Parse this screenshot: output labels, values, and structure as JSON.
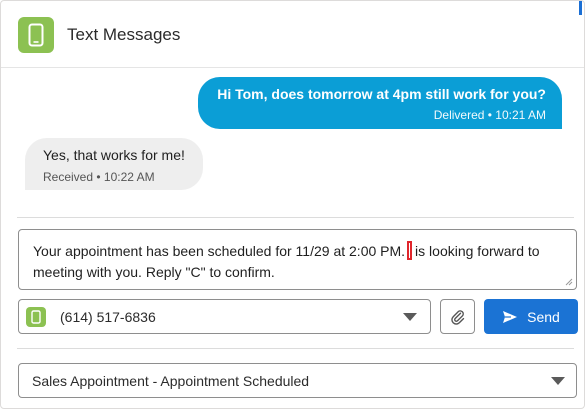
{
  "header": {
    "title": "Text Messages",
    "icon": "mobile-phone-icon",
    "accent_color": "#8cc152"
  },
  "messages": [
    {
      "direction": "outgoing",
      "text": "Hi Tom, does tomorrow at 4pm still work for you?",
      "meta": "Delivered • 10:21 AM",
      "color": "#0b9ed6"
    },
    {
      "direction": "incoming",
      "text": "Yes, that works for me!",
      "meta": "Received • 10:22 AM",
      "color": "#eeeeee"
    }
  ],
  "composer": {
    "text_before_cursor": "Your appointment has been scheduled for 11/29 at 2:00 PM.",
    "text_after_cursor": "is looking forward to meeting with you. Reply \"C\" to confirm."
  },
  "phone_select": {
    "value": "(614) 517-6836",
    "icon": "mobile-phone-icon"
  },
  "attach_button": {
    "icon": "paperclip-icon"
  },
  "send_button": {
    "label": "Send",
    "icon": "send-icon",
    "color": "#1b73d4"
  },
  "template_select": {
    "value": "Sales Appointment - Appointment Scheduled"
  }
}
